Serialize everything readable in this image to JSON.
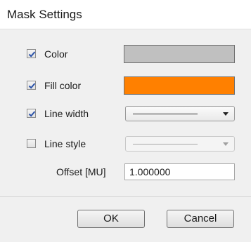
{
  "window": {
    "title": "Mask Settings"
  },
  "options": {
    "color": {
      "label": "Color",
      "checked": true,
      "swatch": "#c0c0c0"
    },
    "fill_color": {
      "label": "Fill color",
      "checked": true,
      "swatch": "#ff8000"
    },
    "line_width": {
      "label": "Line width",
      "checked": true,
      "enabled": true
    },
    "line_style": {
      "label": "Line style",
      "checked": false,
      "enabled": false
    }
  },
  "offset": {
    "label": "Offset [MU]",
    "value": "1.000000"
  },
  "buttons": {
    "ok": "OK",
    "cancel": "Cancel"
  },
  "colors": {
    "accent_check": "#2a52a8"
  }
}
